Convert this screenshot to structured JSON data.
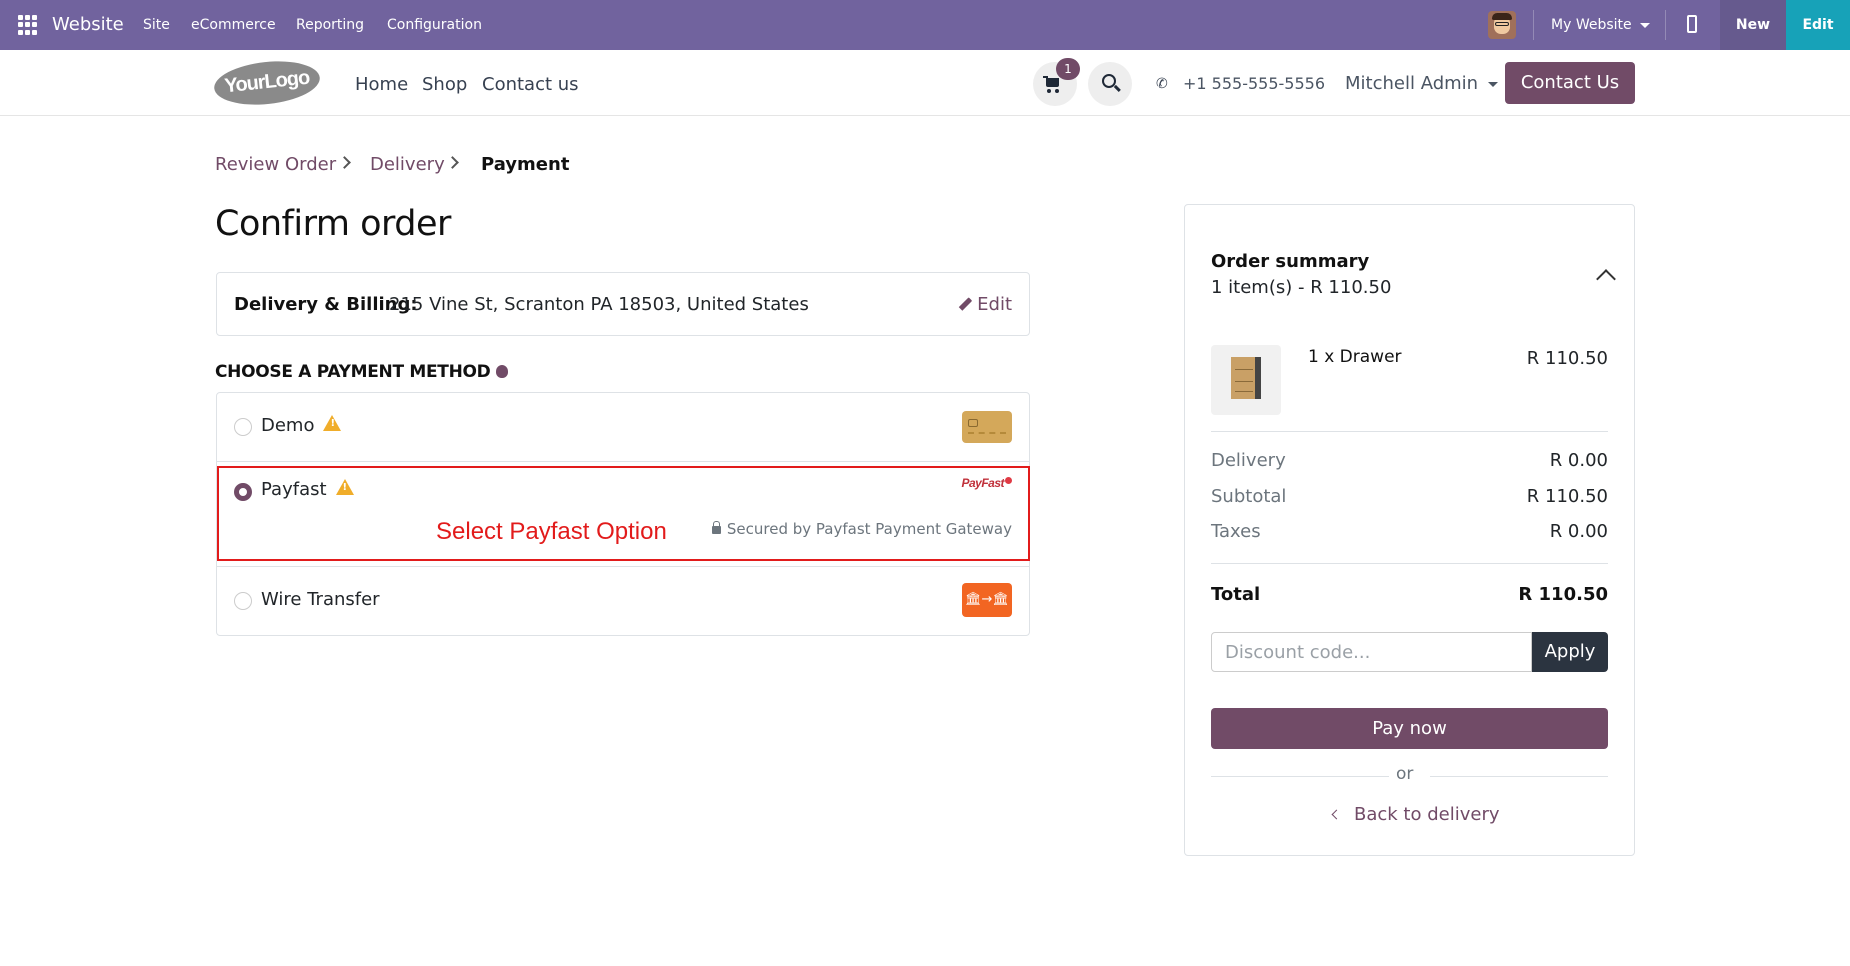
{
  "topbar": {
    "app_name": "Website",
    "menus": [
      "Site",
      "eCommerce",
      "Reporting",
      "Configuration"
    ],
    "website_switcher": "My Website",
    "new_label": "New",
    "edit_label": "Edit"
  },
  "header": {
    "logo_text": "YourLogo",
    "nav": [
      "Home",
      "Shop",
      "Contact us"
    ],
    "cart_count": "1",
    "phone": "+1 555-555-5556",
    "user": "Mitchell Admin",
    "contact_button": "Contact Us"
  },
  "breadcrumb": [
    "Review Order",
    "Delivery",
    "Payment"
  ],
  "page_title": "Confirm order",
  "address": {
    "label": "Delivery & Billing:",
    "value": "215 Vine St, Scranton PA 18503, United States",
    "edit_label": "Edit"
  },
  "payment": {
    "heading": "CHOOSE A PAYMENT METHOD",
    "methods": [
      {
        "name": "Demo",
        "selected": false,
        "warning": true,
        "icon": "credit-card-icon"
      },
      {
        "name": "Payfast",
        "selected": true,
        "warning": true,
        "icon": "payfast-logo",
        "logo_text": "PayFast",
        "secured_text": "Secured by Payfast Payment Gateway"
      },
      {
        "name": "Wire Transfer",
        "selected": false,
        "warning": false,
        "icon": "bank-transfer-icon"
      }
    ]
  },
  "annotation": {
    "text": "Select Payfast Option",
    "color": "#e21b1b"
  },
  "summary": {
    "title": "Order summary",
    "subtitle": "1 item(s) -  R 110.50",
    "item": {
      "name": "1 x Drawer",
      "price": "R 110.50"
    },
    "rows": [
      {
        "label": "Delivery",
        "value": "R 0.00"
      },
      {
        "label": "Subtotal",
        "value": "R 110.50"
      },
      {
        "label": "Taxes",
        "value": "R 0.00"
      }
    ],
    "total_label": "Total",
    "total_value": "R 110.50",
    "discount_placeholder": "Discount code...",
    "apply_label": "Apply",
    "pay_label": "Pay now",
    "or_label": "or",
    "back_label": "Back to delivery"
  },
  "colors": {
    "topbar": "#71639e",
    "brand": "#714b67",
    "edit": "#17a2b8"
  }
}
